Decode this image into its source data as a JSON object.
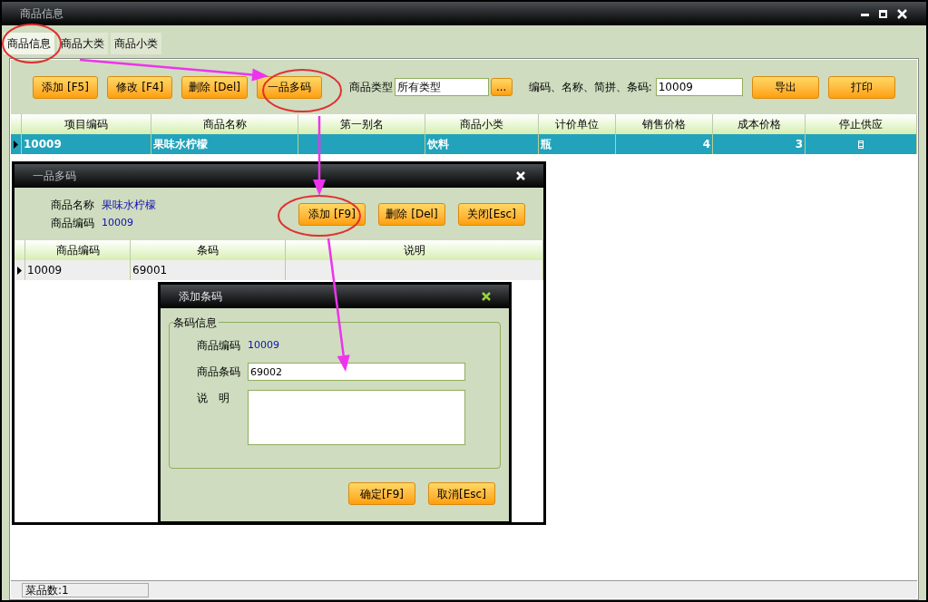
{
  "window": {
    "title": "商品信息",
    "controls": [
      {
        "kind": "minimize"
      },
      {
        "kind": "maximize"
      },
      {
        "kind": "close"
      }
    ]
  },
  "tabs": [
    {
      "label": "商品信息",
      "selected": true
    },
    {
      "label": "商品大类",
      "selected": false
    },
    {
      "label": "商品小类",
      "selected": false
    }
  ],
  "toolbar": {
    "buttons": [
      "添加 [F5]",
      "修改 [F4]",
      "删除 [Del]",
      "一品多码"
    ],
    "type_label": "商品类型",
    "type_value": "所有类型",
    "browse_button": "...",
    "search_label": "编码、名称、简拼、条码:",
    "search_value": "10009",
    "actions": [
      "导出",
      "打印"
    ]
  },
  "table": {
    "columns": [
      "项目编码",
      "商品名称",
      "第一别名",
      "商品小类",
      "计价单位",
      "销售价格",
      "成本价格",
      "停止供应"
    ],
    "rows": [
      {
        "selected": true,
        "cells": [
          "10009",
          "果味水柠檬",
          "",
          "饮料",
          "瓶",
          "4",
          "3"
        ]
      }
    ]
  },
  "status_bar": {
    "text": "菜品数:1"
  },
  "multi_code_dialog": {
    "title": "一品多码",
    "name_label": "商品名称",
    "name_value": "果味水柠檬",
    "code_label": "商品编码",
    "code_value": "10009",
    "buttons": [
      "添加 [F9]",
      "删除 [Del]",
      "关闭[Esc]"
    ],
    "table": {
      "columns": [
        "商品编码",
        "条码",
        "说明"
      ],
      "rows": [
        {
          "selected": true,
          "cells": [
            "10009",
            "69001",
            ""
          ]
        }
      ]
    }
  },
  "add_barcode_dialog": {
    "title": "添加条码",
    "group_label": "条码信息",
    "code_label": "商品编码",
    "code_value": "10009",
    "barcode_label": "商品条码",
    "barcode_value": "69002",
    "note_label": "说　明",
    "buttons": [
      "确定[F9]",
      "取消[Esc]"
    ]
  },
  "annotations": [
    {
      "kind": "circle"
    },
    {
      "kind": "circle"
    },
    {
      "kind": "circle"
    },
    {
      "kind": "arrow"
    },
    {
      "kind": "arrow"
    },
    {
      "kind": "arrow"
    }
  ]
}
